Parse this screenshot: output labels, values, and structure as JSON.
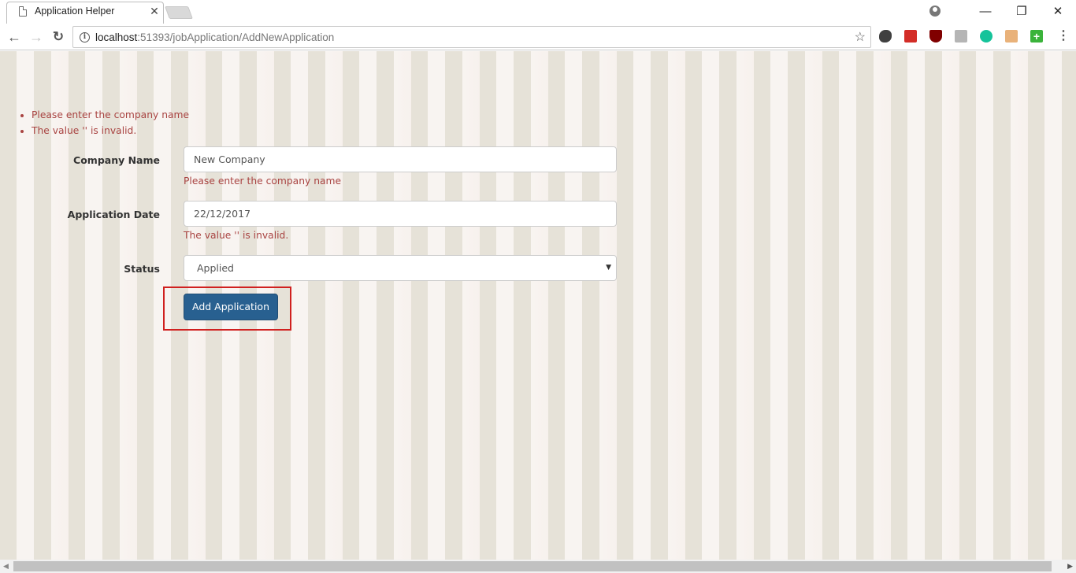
{
  "browser": {
    "tab": {
      "title": "Application Helper",
      "close_glyph": "✕"
    },
    "window_controls": {
      "minimize": "—",
      "restore": "❐",
      "close": "✕"
    },
    "nav": {
      "back": "←",
      "forward": "→",
      "reload": "↻"
    },
    "address": {
      "host": "localhost",
      "rest": ":51393/jobApplication/AddNewApplication"
    },
    "star": "☆",
    "extensions": [
      "evernote-icon",
      "lastpass-icon",
      "ublock-icon",
      "grey-extension-icon",
      "grammarly-icon",
      "face-extension-icon",
      "plus-extension-icon"
    ],
    "extension_plus_glyph": "+",
    "menu": "⋮"
  },
  "page": {
    "validation_summary": [
      "Please enter the company name",
      "The value '' is invalid."
    ],
    "form": {
      "company_name": {
        "label": "Company Name",
        "value": "New Company",
        "error": "Please enter the company name"
      },
      "application_date": {
        "label": "Application Date",
        "value": "22/12/2017",
        "error": "The value '' is invalid."
      },
      "status": {
        "label": "Status",
        "value": "Applied",
        "arrow": "▼"
      },
      "submit_label": "Add Application"
    },
    "colors": {
      "error": "#a94442",
      "primary_button": "#286090",
      "highlight": "#d0201f",
      "stripe_dark": "#e6e2d8",
      "stripe_light": "#f8f4f1"
    }
  },
  "scrollbar": {
    "left_arrow": "◀",
    "right_arrow": "▶"
  }
}
